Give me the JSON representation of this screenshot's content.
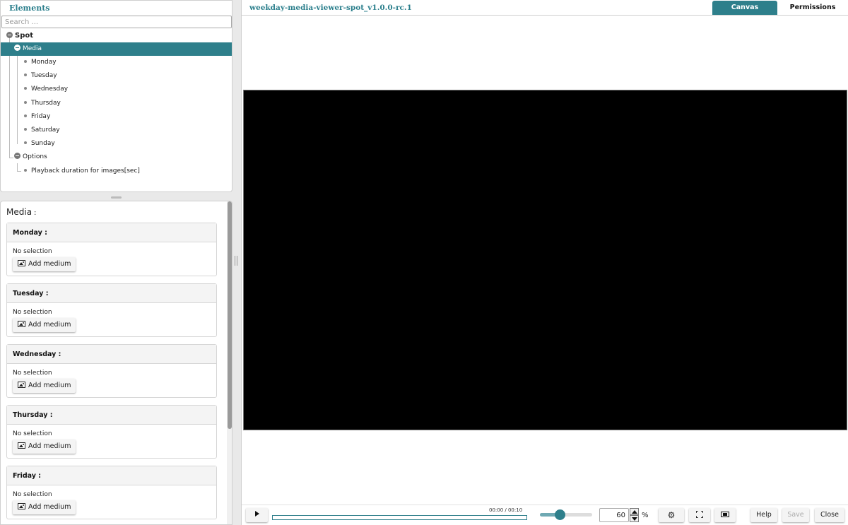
{
  "tree": {
    "title": "Elements",
    "search_placeholder": "Search ...",
    "root": "Spot",
    "media_group": "Media",
    "days": [
      "Monday",
      "Tuesday",
      "Wednesday",
      "Thursday",
      "Friday",
      "Saturday",
      "Sunday"
    ],
    "options_group": "Options",
    "options_items": [
      "Playback duration for images[sec]"
    ]
  },
  "properties": {
    "title": "Media",
    "title_colon": ":",
    "sections": [
      {
        "label": "Monday :",
        "status": "No selection",
        "button": "Add medium"
      },
      {
        "label": "Tuesday :",
        "status": "No selection",
        "button": "Add medium"
      },
      {
        "label": "Wednesday :",
        "status": "No selection",
        "button": "Add medium"
      },
      {
        "label": "Thursday :",
        "status": "No selection",
        "button": "Add medium"
      },
      {
        "label": "Friday :",
        "status": "No selection",
        "button": "Add medium"
      }
    ]
  },
  "header": {
    "project_title": "weekday-media-viewer-spot_v1.0.0-rc.1",
    "tabs": [
      "Canvas",
      "Permissions"
    ],
    "active_tab": "Canvas"
  },
  "toolbar": {
    "time": "00:00 / 00:10",
    "playback_progress": 0,
    "zoom_value": "60",
    "zoom_unit": "%",
    "zoom_slider_level": 0.39,
    "help_label": "Help",
    "save_label": "Save",
    "close_label": "Close"
  },
  "colors": {
    "accent": "#2e7f8b",
    "stage_background": "#000000",
    "disabled_text": "#aaaaaa"
  }
}
